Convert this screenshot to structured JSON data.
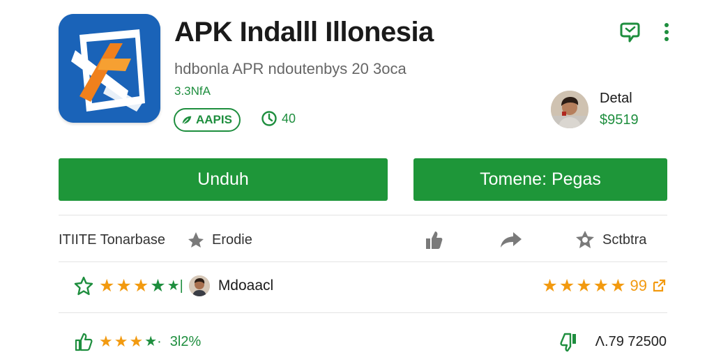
{
  "app": {
    "title": "APK Indalll Illonesia",
    "subtitle": "hdbonla APR ndoutenbys 20 3oca",
    "size": "3.3NfA",
    "badge_label": "AAPIS",
    "rating_count": "40",
    "icon_name": "app-logo-icon"
  },
  "header_actions": [
    {
      "name": "wishlist-icon"
    },
    {
      "name": "more-vert-icon"
    }
  ],
  "developer": {
    "label": "Detal",
    "price": "$9519"
  },
  "buttons": {
    "primary": "Unduh",
    "secondary": "Tomene: Pegas"
  },
  "meta": {
    "category": "ITIITE Tonarbase",
    "editor": "Erodie",
    "share_icon": "share-icon",
    "like_icon": "thumb-up-icon",
    "badge_text": "Sctbtra"
  },
  "reviews": [
    {
      "name": "Mdoaacl",
      "score_suffix": "99",
      "left_stars": 4.5,
      "right_stars": 5
    },
    {
      "percent": "3l2%",
      "installs": "Λ.79 72500",
      "left_stars": 3.5
    }
  ],
  "colors": {
    "accent": "#1e9639",
    "text_green": "#1e8e3e",
    "star": "#f29a10",
    "icon_blue": "#1a63b8",
    "icon_orange": "#f0801c"
  }
}
